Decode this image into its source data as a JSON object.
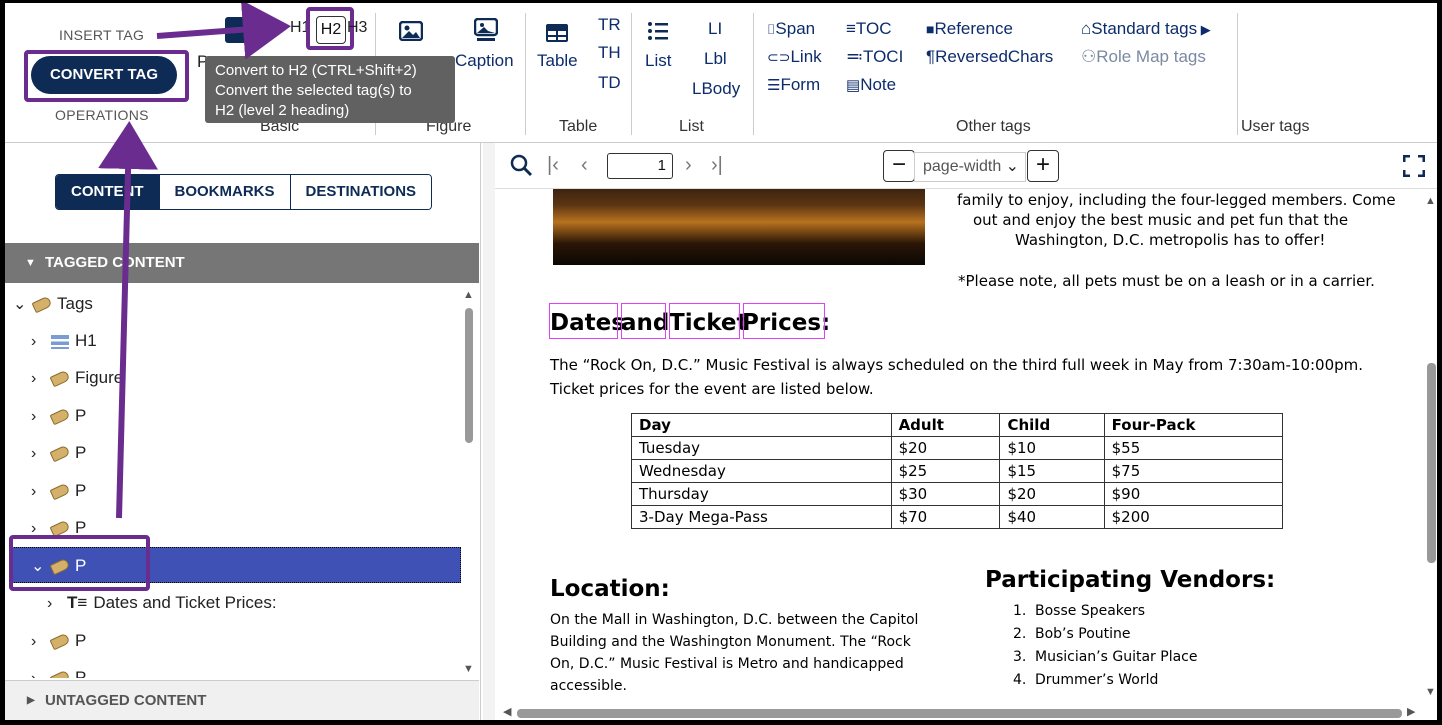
{
  "toolbar": {
    "insert_tag": "INSERT TAG",
    "convert_tag": "CONVERT TAG",
    "operations": "OPERATIONS",
    "basic": {
      "title": "Basic",
      "h1": "H1",
      "h2": "H2",
      "h3": "H3",
      "p_partial": "P"
    },
    "figure": {
      "title": "Figure",
      "caption": "Caption"
    },
    "table": {
      "title": "Table",
      "table": "Table",
      "tr": "TR",
      "th": "TH",
      "td": "TD"
    },
    "list": {
      "title": "List",
      "list": "List",
      "li": "LI",
      "lbl": "Lbl",
      "lbody": "LBody"
    },
    "other": {
      "title": "Other tags",
      "span": "Span",
      "link": "Link",
      "form": "Form",
      "toc": "TOC",
      "toci": "TOCI",
      "note": "Note",
      "reference": "Reference",
      "reversed_chars": "ReversedChars",
      "standard_tags": "Standard tags",
      "role_map_tags": "Role Map tags"
    },
    "user_tags": "User tags"
  },
  "tooltip": {
    "line1": "Convert to H2 (CTRL+Shift+2)",
    "line2": "Convert the selected tag(s) to",
    "line3": "H2 (level 2 heading)"
  },
  "left_panel": {
    "tabs": [
      "CONTENT",
      "BOOKMARKS",
      "DESTINATIONS"
    ],
    "tagged_content": "TAGGED CONTENT",
    "untagged_content": "UNTAGGED CONTENT",
    "tree": {
      "root": "Tags",
      "h1": "H1",
      "figure": "Figure",
      "p": "P",
      "child_text": "Dates and Ticket Prices:"
    }
  },
  "viewer": {
    "page": "1",
    "zoom": "page-width"
  },
  "document": {
    "intro_line1": "family to enjoy, including the four-legged members.  Come",
    "intro_line2": "out and enjoy the best music and pet fun that the",
    "intro_line3": "Washington, D.C. metropolis has to offer!",
    "note": "*Please note, all pets must be on a leash or in a carrier.",
    "heading_words": [
      "Dates",
      "and",
      "Ticket",
      "Prices:"
    ],
    "para_line1": "The “Rock On, D.C.” Music Festival is always scheduled on the third full week in May from 7:30am-10:00pm.",
    "para_line2": "Ticket prices for the event are listed below.",
    "table": {
      "headers": [
        "Day",
        "Adult",
        "Child",
        "Four-Pack"
      ],
      "rows": [
        [
          "Tuesday",
          "$20",
          "$10",
          "$55"
        ],
        [
          "Wednesday",
          "$25",
          "$15",
          "$75"
        ],
        [
          "Thursday",
          "$30",
          "$20",
          "$90"
        ],
        [
          "3-Day Mega-Pass",
          "$70",
          "$40",
          "$200"
        ]
      ]
    },
    "location_title": "Location:",
    "location_line1": "On the Mall in Washington, D.C. between the Capitol",
    "location_line2": "Building and the Washington Monument.  The “Rock",
    "location_line3": "On, D.C.” Music Festival is Metro and handicapped",
    "location_line4": "accessible.",
    "vendors_title": "Participating Vendors:",
    "vendors": [
      "Bosse Speakers",
      "Bob’s Poutine",
      "Musician’s Guitar Place",
      "Drummer’s World"
    ],
    "vendor_numbers": [
      "1.",
      "2.",
      "3.",
      "4."
    ]
  },
  "colors": {
    "navy": "#0d2b55",
    "highlight_purple": "#6a2d8f",
    "selection_blue": "#3f51b5",
    "tag_box_magenta": "#e040fb"
  }
}
